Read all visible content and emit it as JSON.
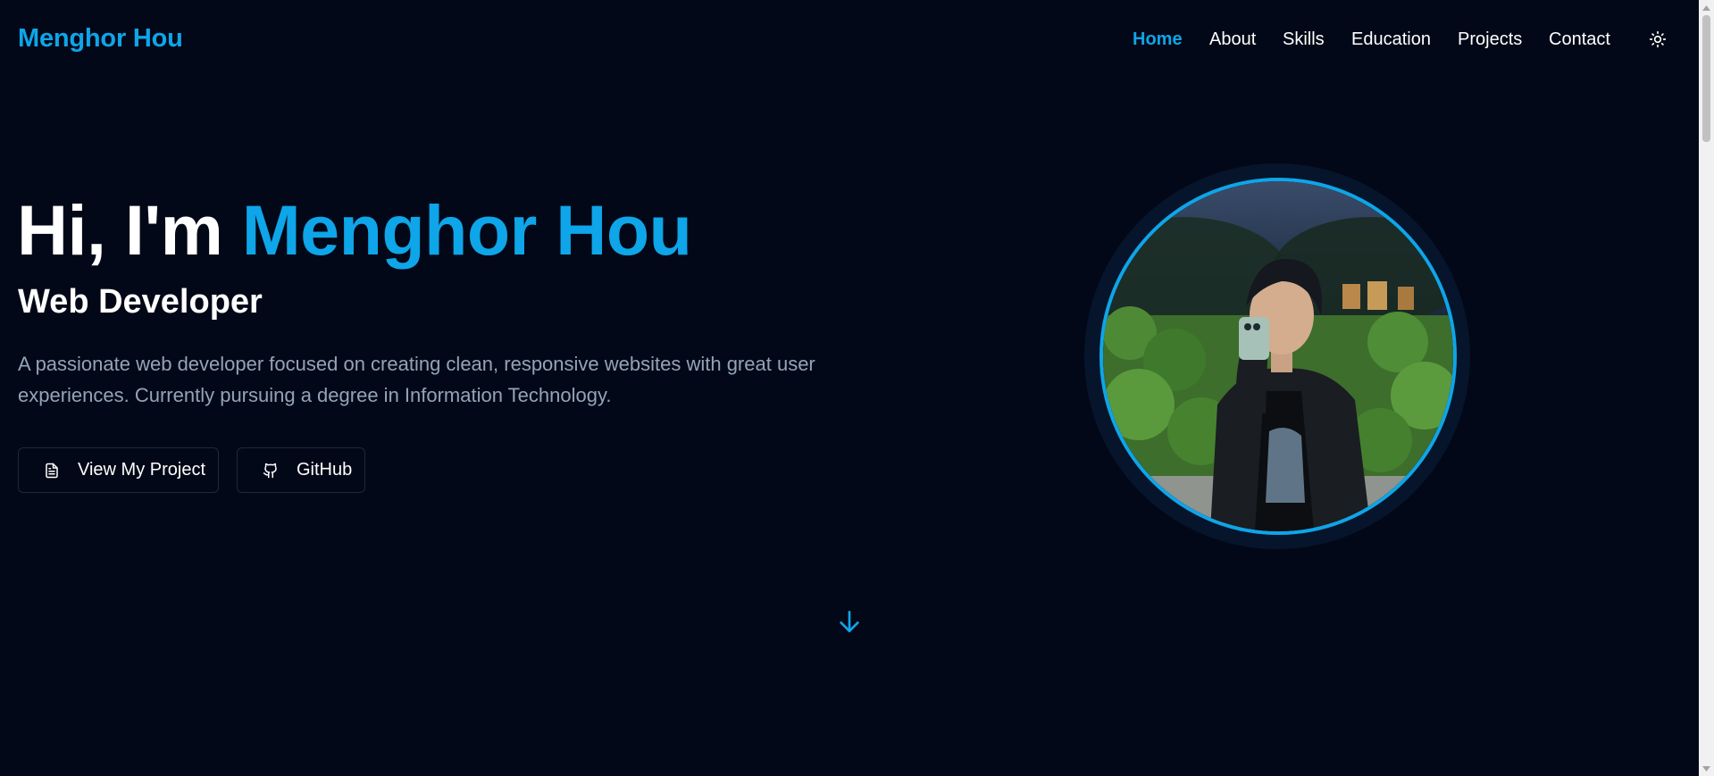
{
  "header": {
    "brand": "Menghor Hou",
    "nav": [
      {
        "label": "Home",
        "active": true
      },
      {
        "label": "About",
        "active": false
      },
      {
        "label": "Skills",
        "active": false
      },
      {
        "label": "Education",
        "active": false
      },
      {
        "label": "Projects",
        "active": false
      },
      {
        "label": "Contact",
        "active": false
      }
    ],
    "theme_toggle_icon": "sun-icon"
  },
  "hero": {
    "greeting": "Hi, I'm",
    "name": "Menghor Hou",
    "role": "Web Developer",
    "intro": "A passionate web developer focused on creating clean, responsive websites with great user experiences. Currently pursuing a degree in Information Technology.",
    "buttons": {
      "project": {
        "label": "View My Project",
        "icon": "document-icon"
      },
      "github": {
        "label": "GitHub",
        "icon": "github-icon"
      }
    },
    "scroll_icon": "arrow-down-icon"
  },
  "colors": {
    "background": "#020817",
    "accent": "#0ea5e9",
    "muted_text": "#94a3b8",
    "border": "#1e293b"
  }
}
